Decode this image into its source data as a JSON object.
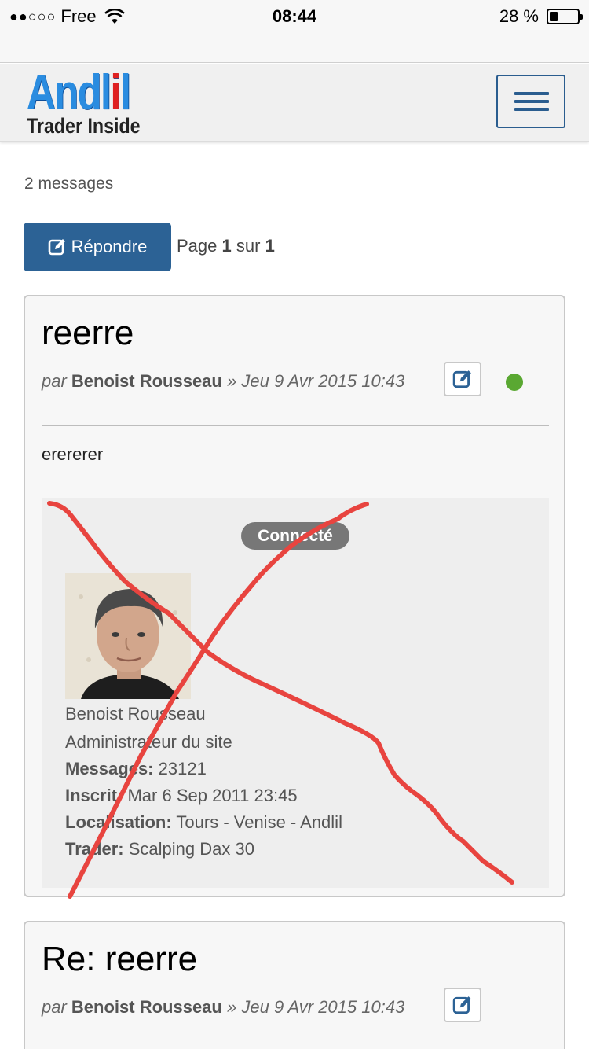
{
  "status_bar": {
    "carrier": "Free",
    "signal_dots": "●●○○○",
    "time": "08:44",
    "battery_text": "28 %",
    "battery_level": 0.28
  },
  "header": {
    "logo_text_top_a": "Andl",
    "logo_text_top_b": "i",
    "logo_text_top_c": "l",
    "logo_text_bottom": "Trader Inside",
    "menu_icon": "hamburger-icon"
  },
  "topic": {
    "message_count": "2 messages",
    "reply_label": "Répondre",
    "page_prefix": "Page",
    "page_current": "1",
    "page_sep": "sur",
    "page_total": "1"
  },
  "posts": [
    {
      "title": "reerre",
      "by": "par",
      "author": "Benoist Rousseau",
      "date_sep": "»",
      "date": "Jeu 9 Avr 2015 10:43",
      "body": "erererer",
      "online": true,
      "online_color": "#5aa832",
      "profile": {
        "status_badge": "Connecté",
        "name": "Benoist Rousseau",
        "rank": "Administrateur du site",
        "messages_label": "Messages:",
        "messages_value": "23121",
        "joined_label": "Inscrit:",
        "joined_value": "Mar 6 Sep 2011 23:45",
        "location_label": "Localisation:",
        "location_value": "Tours - Venise - Andlil",
        "trader_label": "Trader:",
        "trader_value": "Scalping Dax 30"
      }
    },
    {
      "title": "Re: reerre",
      "by": "par",
      "author": "Benoist Rousseau",
      "date_sep": "»",
      "date": "Jeu 9 Avr 2015 10:43"
    }
  ],
  "colors": {
    "primary": "#2c6295",
    "logo_blue": "#2a8ce0",
    "logo_red": "#e02020",
    "scribble_red": "#e8443f"
  }
}
